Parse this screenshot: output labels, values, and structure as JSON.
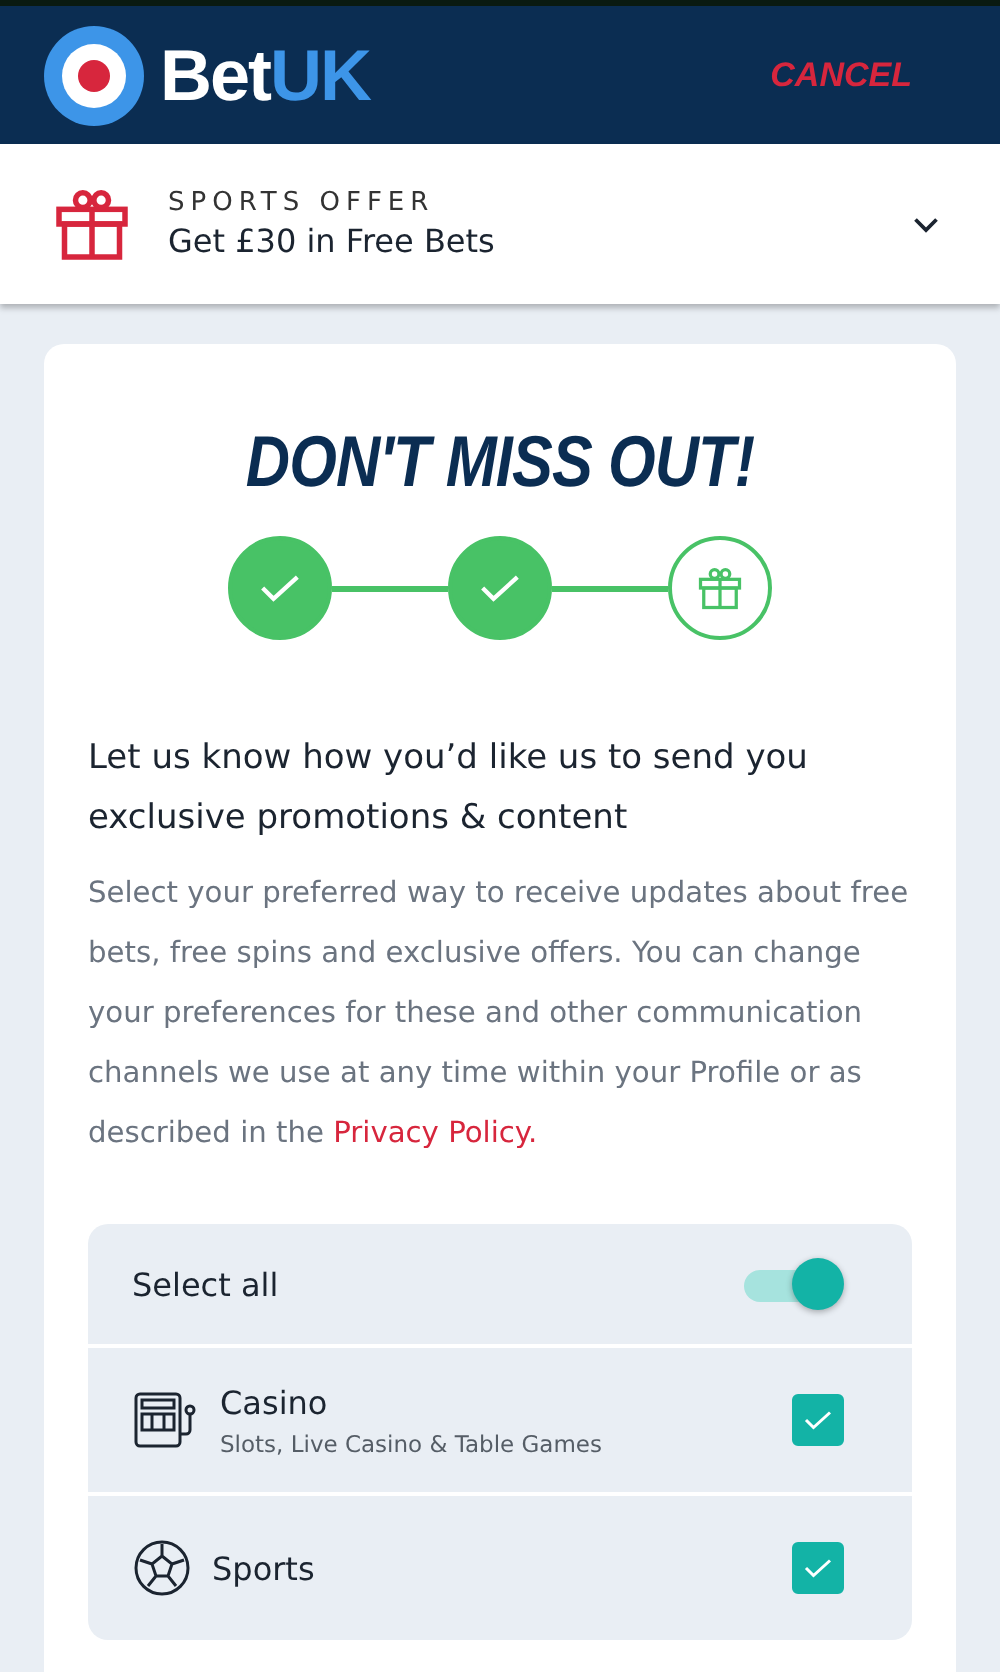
{
  "header": {
    "logo": {
      "text": "Bet",
      "accent": "UK"
    },
    "cancel": "CANCEL"
  },
  "offer": {
    "label": "SPORTS OFFER",
    "title": "Get £30 in Free Bets",
    "expanded": false
  },
  "card": {
    "title": "DON'T MISS OUT!",
    "steps": [
      {
        "kind": "check",
        "done": true
      },
      {
        "kind": "check",
        "done": true
      },
      {
        "kind": "gift",
        "done": false
      }
    ],
    "heading": "Let us know how you’d like us to send you exclusive promotions & content",
    "body": "Select your preferred way to receive updates about free bets, free spins and exclusive offers. You can change your preferences for these and other communication channels we use at any time within your Profile or as described in the",
    "link": "Privacy Policy.",
    "select_all": {
      "label": "Select all",
      "on": true
    },
    "preferences": [
      {
        "kind": "casino",
        "title": "Casino",
        "subtitle": "Slots, Live Casino & Table Games",
        "checked": true
      },
      {
        "kind": "sports",
        "title": "Sports",
        "checked": true
      }
    ]
  }
}
